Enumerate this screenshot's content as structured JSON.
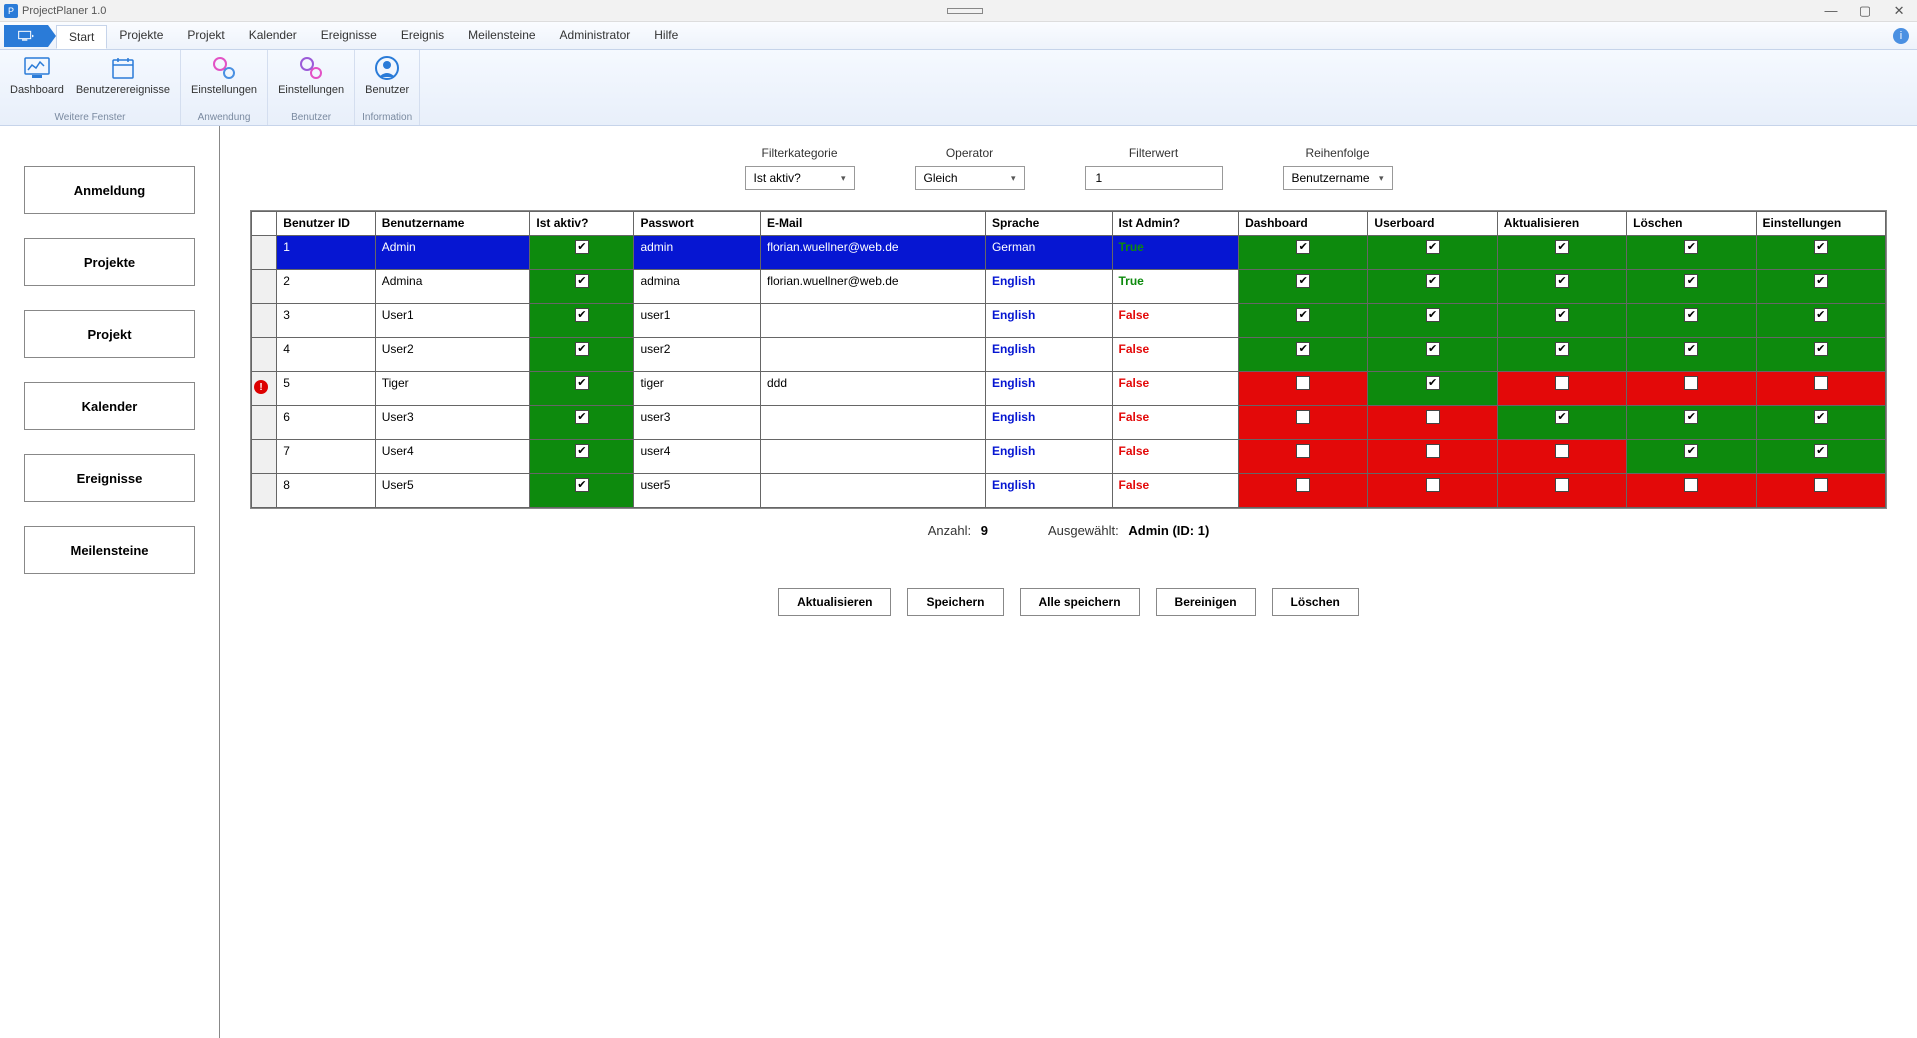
{
  "app": {
    "title": "ProjectPlaner 1.0"
  },
  "window_buttons": {
    "min": "—",
    "max": "▢",
    "close": "✕"
  },
  "menu": {
    "tabs": [
      "Start",
      "Projekte",
      "Projekt",
      "Kalender",
      "Ereignisse",
      "Ereignis",
      "Meilensteine",
      "Administrator",
      "Hilfe"
    ],
    "active": 0
  },
  "ribbon": {
    "groups": [
      {
        "label": "Weitere Fenster",
        "items": [
          {
            "name": "dashboard",
            "label": "Dashboard",
            "icon": "dashboard-icon"
          },
          {
            "name": "user-events",
            "label": "Benutzerereignisse",
            "icon": "calendar-icon"
          }
        ]
      },
      {
        "label": "Anwendung",
        "items": [
          {
            "name": "settings-app",
            "label": "Einstellungen",
            "icon": "gear-pink-icon"
          }
        ]
      },
      {
        "label": "Benutzer",
        "items": [
          {
            "name": "settings-user",
            "label": "Einstellungen",
            "icon": "gear-purple-icon"
          }
        ]
      },
      {
        "label": "Information",
        "items": [
          {
            "name": "user-info",
            "label": "Benutzer",
            "icon": "user-circle-icon"
          }
        ]
      }
    ]
  },
  "sidebar": {
    "items": [
      {
        "name": "login",
        "label": "Anmeldung"
      },
      {
        "name": "projects",
        "label": "Projekte"
      },
      {
        "name": "project",
        "label": "Projekt"
      },
      {
        "name": "calendar",
        "label": "Kalender"
      },
      {
        "name": "events",
        "label": "Ereignisse"
      },
      {
        "name": "milestones",
        "label": "Meilensteine"
      }
    ]
  },
  "filters": {
    "category": {
      "label": "Filterkategorie",
      "value": "Ist aktiv?"
    },
    "operator": {
      "label": "Operator",
      "value": "Gleich"
    },
    "filterwert": {
      "label": "Filterwert",
      "value": "1"
    },
    "order": {
      "label": "Reihenfolge",
      "value": "Benutzername"
    }
  },
  "grid": {
    "columns": [
      "Benutzer ID",
      "Benutzername",
      "Ist aktiv?",
      "Passwort",
      "E-Mail",
      "Sprache",
      "Ist Admin?",
      "Dashboard",
      "Userboard",
      "Aktualisieren",
      "Löschen",
      "Einstellungen"
    ],
    "rows": [
      {
        "id": "1",
        "name": "Admin",
        "active": true,
        "pw": "admin",
        "mail": "florian.wuellner@web.de",
        "lang": "German",
        "admin": "True",
        "perms": [
          true,
          true,
          true,
          true,
          true
        ],
        "selected": true
      },
      {
        "id": "2",
        "name": "Admina",
        "active": true,
        "pw": "admina",
        "mail": "florian.wuellner@web.de",
        "lang": "English",
        "admin": "True",
        "perms": [
          true,
          true,
          true,
          true,
          true
        ]
      },
      {
        "id": "3",
        "name": "User1",
        "active": true,
        "pw": "user1",
        "mail": "",
        "lang": "English",
        "admin": "False",
        "perms": [
          true,
          true,
          true,
          true,
          true
        ]
      },
      {
        "id": "4",
        "name": "User2",
        "active": true,
        "pw": "user2",
        "mail": "",
        "lang": "English",
        "admin": "False",
        "perms": [
          true,
          true,
          true,
          true,
          true
        ]
      },
      {
        "id": "5",
        "name": "Tiger",
        "active": true,
        "pw": "tiger",
        "mail": "ddd",
        "lang": "English",
        "admin": "False",
        "perms": [
          false,
          true,
          false,
          false,
          false
        ],
        "error": true
      },
      {
        "id": "6",
        "name": "User3",
        "active": true,
        "pw": "user3",
        "mail": "",
        "lang": "English",
        "admin": "False",
        "perms": [
          false,
          false,
          true,
          true,
          true
        ]
      },
      {
        "id": "7",
        "name": "User4",
        "active": true,
        "pw": "user4",
        "mail": "",
        "lang": "English",
        "admin": "False",
        "perms": [
          false,
          false,
          false,
          true,
          true
        ]
      },
      {
        "id": "8",
        "name": "User5",
        "active": true,
        "pw": "user5",
        "mail": "",
        "lang": "English",
        "admin": "False",
        "perms": [
          false,
          false,
          false,
          false,
          false
        ]
      }
    ]
  },
  "status": {
    "count_label": "Anzahl:",
    "count": "9",
    "selected_label": "Ausgewählt:",
    "selected": "Admin (ID: 1)"
  },
  "actions": {
    "refresh": "Aktualisieren",
    "save": "Speichern",
    "saveall": "Alle speichern",
    "cleanup": "Bereinigen",
    "delete": "Löschen"
  }
}
